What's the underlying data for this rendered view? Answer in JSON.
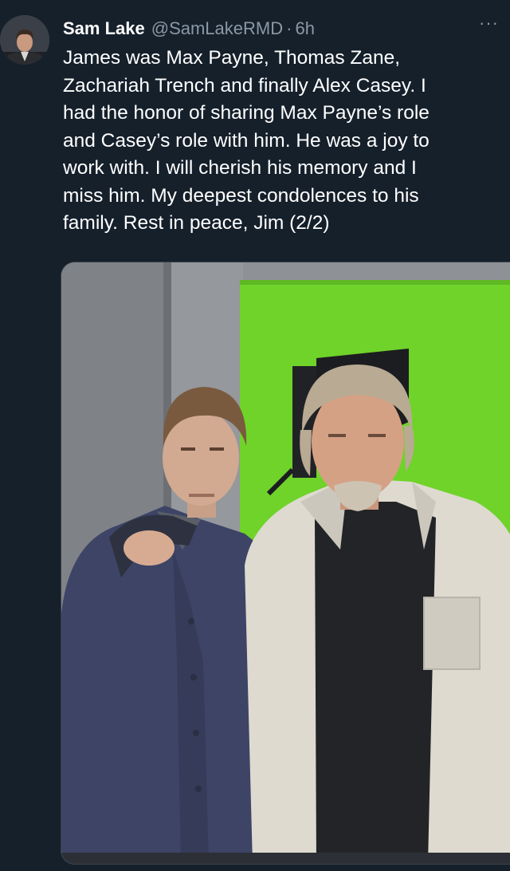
{
  "tweet": {
    "author_name": "Sam Lake",
    "handle": "@SamLakeRMD",
    "separator": "·",
    "time": "6h",
    "more_icon": "···",
    "text_lines": [
      "James was Max Payne, Thomas Zane,",
      "Zachariah Trench and finally Alex Casey. I",
      "had the honor of sharing Max Payne’s role",
      "and Casey’s role with him. He was a joy to",
      "work with. I will cherish his memory and I",
      "miss him. My deepest condolences to his",
      "family. Rest in peace, Jim (2/2)"
    ]
  },
  "colors": {
    "background": "#15202b",
    "secondary_text": "#8b98a5",
    "green_screen": "#6fd32a"
  },
  "icons": {
    "more": "more-options-icon",
    "avatar": "profile-avatar"
  }
}
